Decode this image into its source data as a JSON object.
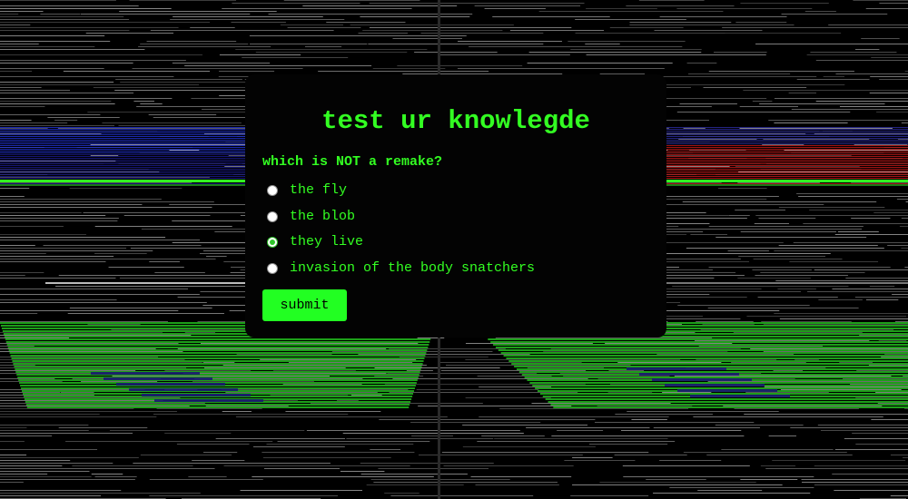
{
  "quiz": {
    "title": "test ur knowlegde",
    "question": "which is NOT a remake?",
    "options": [
      {
        "label": "the fly",
        "selected": false
      },
      {
        "label": "the blob",
        "selected": false
      },
      {
        "label": "they live",
        "selected": true
      },
      {
        "label": "invasion of the body snatchers",
        "selected": false
      }
    ],
    "submit_label": "submit"
  },
  "colors": {
    "accent": "#33ff22",
    "button": "#22ff22",
    "panel": "#030303",
    "background": "#000000"
  }
}
